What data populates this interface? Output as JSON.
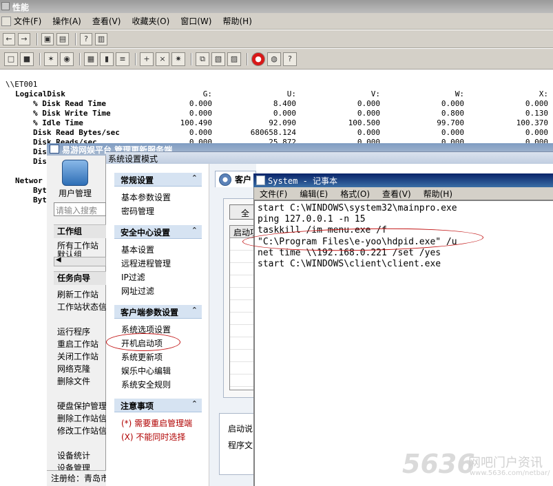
{
  "perfmon": {
    "title": "性能",
    "menu": [
      "文件(F)",
      "操作(A)",
      "查看(V)",
      "收藏夹(O)",
      "窗口(W)",
      "帮助(H)"
    ],
    "server": "\\\\ET001",
    "object": "LogicalDisk",
    "columns": [
      "G:",
      "U:",
      "V:",
      "W:",
      "X:"
    ],
    "rows": [
      {
        "label": "% Disk Read Time",
        "values": [
          "0.000",
          "8.400",
          "0.000",
          "0.000",
          "0.000"
        ]
      },
      {
        "label": "% Disk Write Time",
        "values": [
          "0.000",
          "0.000",
          "0.000",
          "0.800",
          "0.130"
        ]
      },
      {
        "label": "% Idle Time",
        "values": [
          "100.490",
          "92.090",
          "100.500",
          "99.700",
          "100.370"
        ]
      },
      {
        "label": "Disk Read Bytes/sec",
        "values": [
          "0.000",
          "680658.124",
          "0.000",
          "0.000",
          "0.000"
        ]
      },
      {
        "label": "Disk Reads/sec",
        "values": [
          "0.000",
          "25.872",
          "0.000",
          "0.000",
          "0.000"
        ]
      }
    ],
    "partial_rows": [
      "Dis",
      "Dis"
    ],
    "network_partial": [
      "Networ",
      "Byt",
      "Byt"
    ]
  },
  "erp": {
    "title": "易游网娱平台 管理更新服务端",
    "user_mgmt": "用户管理",
    "search_placeholder": "请输入搜索",
    "workgroup_head": "工作组",
    "workgroup_items": [
      "所有工作站",
      "默认组"
    ],
    "task_head": "任务向导",
    "task_items_a": [
      "刷新工作站",
      "工作站状态信"
    ],
    "task_items_b": [
      "运行程序",
      "重启工作站",
      "关闭工作站",
      "网络克隆",
      "删除文件"
    ],
    "task_items_c": [
      "硬盘保护管理",
      "删除工作站信",
      "修改工作站信"
    ],
    "task_items_d": [
      "设备统计",
      "设备管理"
    ],
    "registered": "注册给：青岛市"
  },
  "settings": {
    "title": "系统设置模式",
    "sections": [
      {
        "title": "常规设置",
        "items": [
          "基本参数设置",
          "密码管理"
        ]
      },
      {
        "title": "安全中心设置",
        "items": [
          "基本设置",
          "远程进程管理",
          "IP过滤",
          "网址过滤"
        ]
      },
      {
        "title": "客户端参数设置",
        "items": [
          "系统选项设置",
          "开机启动项",
          "系统更新项",
          "娱乐中心编辑",
          "系统安全规则"
        ]
      },
      {
        "title": "注意事项",
        "items": []
      }
    ],
    "notes": [
      "(*) 需要重启管理端",
      "(X) 不能同时选择"
    ],
    "client_tab": "客户",
    "all_button": "全",
    "grid_header": "启动项",
    "desc_lines": [
      "启动说",
      "程序文"
    ]
  },
  "notepad": {
    "title": "System - 记事本",
    "menu": [
      "文件(F)",
      "编辑(E)",
      "格式(O)",
      "查看(V)",
      "帮助(H)"
    ],
    "lines": [
      "start C:\\WINDOWS\\system32\\mainpro.exe",
      "ping 127.0.0.1 -n 15",
      "taskkill /im menu.exe /f",
      "\"C:\\Program Files\\e-yoo\\hdpid.exe\" /u",
      "net time \\\\192.168.0.221 /set /yes",
      "start C:\\WINDOWS\\client\\client.exe"
    ]
  },
  "watermark": {
    "big": "5636",
    "cn": "网吧门户资讯",
    "url": "www.5636.com/netbar/"
  }
}
